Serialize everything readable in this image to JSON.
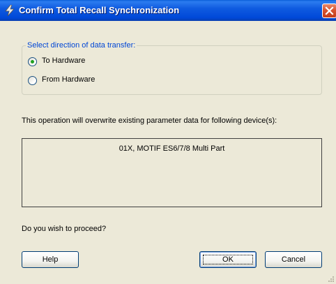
{
  "window": {
    "title": "Confirm Total Recall Synchronization",
    "icons": {
      "app": "lightning-bolt-icon",
      "close": "close-x-icon"
    }
  },
  "direction_group": {
    "legend": "Select direction of data transfer:",
    "options": [
      {
        "label": "To Hardware",
        "selected": true
      },
      {
        "label": "From Hardware",
        "selected": false
      }
    ]
  },
  "message": "This operation will overwrite existing parameter data for following device(s):",
  "devices": [
    "01X, MOTIF ES6/7/8 Multi Part"
  ],
  "question": "Do you wish to proceed?",
  "buttons": {
    "help": "Help",
    "ok": "OK",
    "cancel": "Cancel"
  },
  "colors": {
    "titlebar": "#0054E3",
    "dialog_bg": "#ECE9D8",
    "group_label": "#0046D5",
    "close_button": "#D8532F",
    "radio_selected_dot": "#21A121"
  }
}
